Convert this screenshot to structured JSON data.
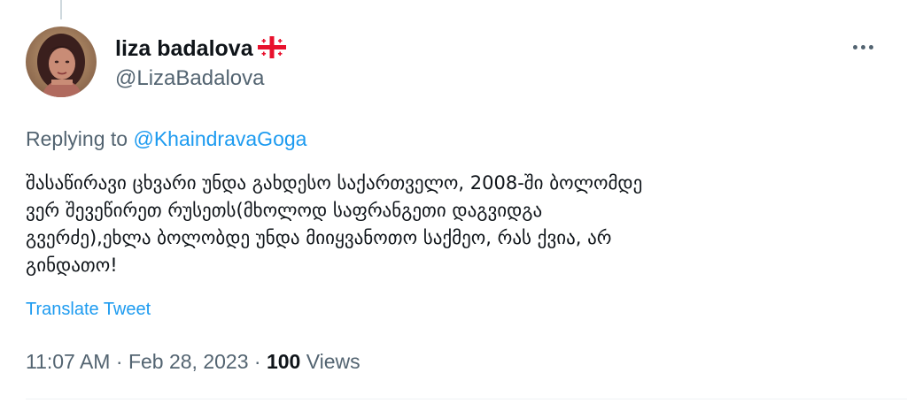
{
  "tweet": {
    "author": {
      "display_name": "liza badalova",
      "flag_icon": "georgia-flag-icon",
      "handle": "@LizaBadalova"
    },
    "more_icon": "more-horizontal-icon",
    "replying": {
      "prefix": "Replying to",
      "mention": "@KhaindravaGoga"
    },
    "text_lines": [
      "შასაწირავი ცხვარი უნდა გახდესო საქართველო, 2008-ში ბოლომდე",
      "ვერ შევეწირეთ რუსეთს(მხოლოდ საფრანგეთი დაგვიდგა",
      "გვერძე),ეხლა ბოლობდე უნდა მიიყვანოთო საქმეო, რას ქვია, არ",
      "გინდათო!"
    ],
    "translate_label": "Translate Tweet",
    "meta": {
      "time": "11:07 AM",
      "separator": "·",
      "date": "Feb 28, 2023",
      "views_count": "100",
      "views_label": "Views"
    }
  },
  "colors": {
    "text_primary": "#0f1419",
    "text_secondary": "#536471",
    "link": "#1d9bf0",
    "divider": "#eff3f4",
    "flag_red": "#e8112d"
  }
}
